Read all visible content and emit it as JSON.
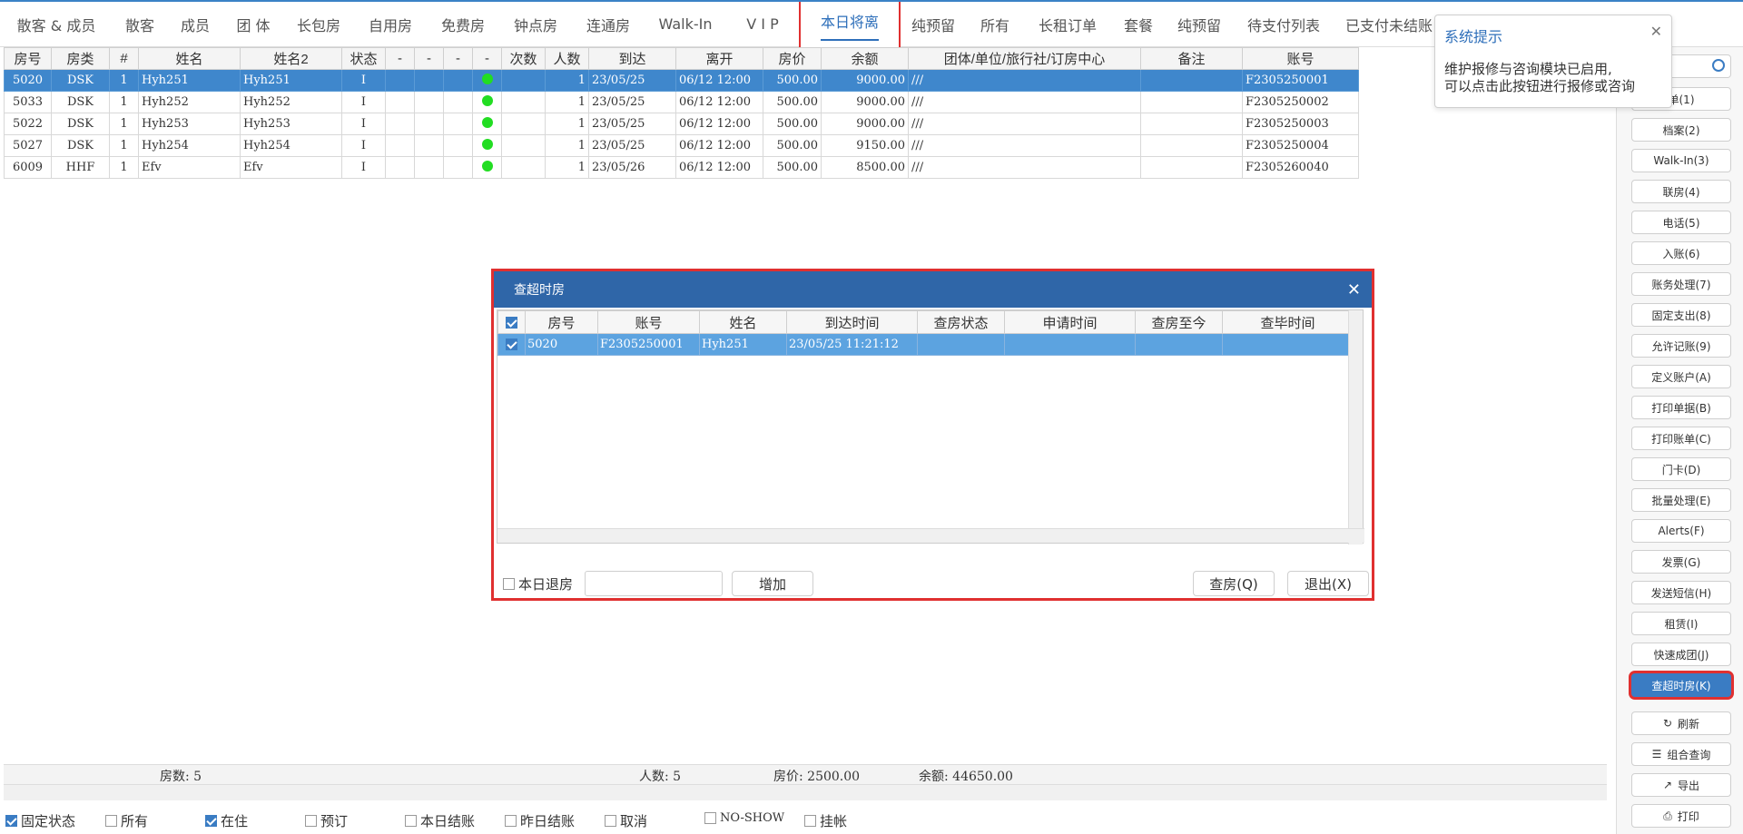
{
  "tabs": [
    "散客 & 成员",
    "散客",
    "成员",
    "团 体",
    "长包房",
    "自用房",
    "免费房",
    "钟点房",
    "连通房",
    "Walk-In",
    "V I P",
    "本日将离",
    "纯预留",
    "所有",
    "长租订单",
    "套餐",
    "纯预留",
    "待支付列表",
    "已支付未结账"
  ],
  "active_tab": "本日将离",
  "grid": {
    "headers": [
      "房号",
      "房类",
      "#",
      "姓名",
      "姓名2",
      "状态",
      "-",
      "-",
      "-",
      "-",
      "次数",
      "人数",
      "到达",
      "离开",
      "房价",
      "余额",
      "团体/单位/旅行社/订房中心",
      "备注",
      "账号"
    ],
    "rows": [
      {
        "room": "5020",
        "type": "DSK",
        "n": "1",
        "name": "Hyh251",
        "name2": "Hyh251",
        "status": "I",
        "people": "1",
        "arrive": "23/05/25",
        "leave": "06/12 12:00",
        "rate": "500.00",
        "balance": "9000.00",
        "group": "///",
        "note": "",
        "account": "F2305250001",
        "selected": true
      },
      {
        "room": "5033",
        "type": "DSK",
        "n": "1",
        "name": "Hyh252",
        "name2": "Hyh252",
        "status": "I",
        "people": "1",
        "arrive": "23/05/25",
        "leave": "06/12 12:00",
        "rate": "500.00",
        "balance": "9000.00",
        "group": "///",
        "note": "",
        "account": "F2305250002"
      },
      {
        "room": "5022",
        "type": "DSK",
        "n": "1",
        "name": "Hyh253",
        "name2": "Hyh253",
        "status": "I",
        "people": "1",
        "arrive": "23/05/25",
        "leave": "06/12 12:00",
        "rate": "500.00",
        "balance": "9000.00",
        "group": "///",
        "note": "",
        "account": "F2305250003"
      },
      {
        "room": "5027",
        "type": "DSK",
        "n": "1",
        "name": "Hyh254",
        "name2": "Hyh254",
        "status": "I",
        "people": "1",
        "arrive": "23/05/25",
        "leave": "06/12 12:00",
        "rate": "500.00",
        "balance": "9150.00",
        "group": "///",
        "note": "",
        "account": "F2305250004"
      },
      {
        "room": "6009",
        "type": "HHF",
        "n": "1",
        "name": "Efv",
        "name2": "Efv",
        "status": "I",
        "people": "1",
        "arrive": "23/05/26",
        "leave": "06/12 12:00",
        "rate": "500.00",
        "balance": "8500.00",
        "group": "///",
        "note": "",
        "account": "F2305260040"
      }
    ]
  },
  "tooltip": {
    "title": "系统提示",
    "line1": "维护报修与咨询模块已启用,",
    "line2": "可以点击此按钮进行报修或咨询"
  },
  "right_buttons": [
    "单(1)",
    "档案(2)",
    "Walk-In(3)",
    "联房(4)",
    "电话(5)",
    "入账(6)",
    "账务处理(7)",
    "固定支出(8)",
    "允许记账(9)",
    "定义账户(A)",
    "打印单据(B)",
    "打印账单(C)",
    "门卡(D)",
    "批量处理(E)",
    "Alerts(F)",
    "发票(G)",
    "发送短信(H)",
    "租赁(I)",
    "快速成团(J)",
    "查超时房(K)",
    "刷新",
    "组合查询",
    "导出",
    "打印"
  ],
  "modal": {
    "title": "查超时房",
    "headers": [
      "房号",
      "账号",
      "姓名",
      "到达时间",
      "查房状态",
      "申请时间",
      "查房至今",
      "查毕时间"
    ],
    "row": {
      "room": "5020",
      "account": "F2305250001",
      "name": "Hyh251",
      "arrive": "23/05/25 11:21:12",
      "status": "",
      "apply": "",
      "elapsed": "",
      "done": ""
    },
    "footer": {
      "checkbox_label": "本日退房",
      "input_value": "",
      "add_label": "增加",
      "check_label": "查房(Q)",
      "exit_label": "退出(X)"
    }
  },
  "summary": {
    "rooms": "房数: 5",
    "people": "人数: 5",
    "rate": "房价: 2500.00",
    "balance": "余额: 44650.00"
  },
  "filters": [
    {
      "label": "固定状态",
      "checked": true
    },
    {
      "label": "所有",
      "checked": false
    },
    {
      "label": "在住",
      "checked": true
    },
    {
      "label": "预订",
      "checked": false
    },
    {
      "label": "本日结账",
      "checked": false
    },
    {
      "label": "昨日结账",
      "checked": false
    },
    {
      "label": "取消",
      "checked": false
    },
    {
      "label": "NO-SHOW",
      "checked": false
    },
    {
      "label": "挂帐",
      "checked": false
    }
  ],
  "colors": {
    "accent": "#2e6fba",
    "highlight": "#e03030",
    "selected_row": "#3f87cc",
    "status_dot": "#22dd22"
  }
}
